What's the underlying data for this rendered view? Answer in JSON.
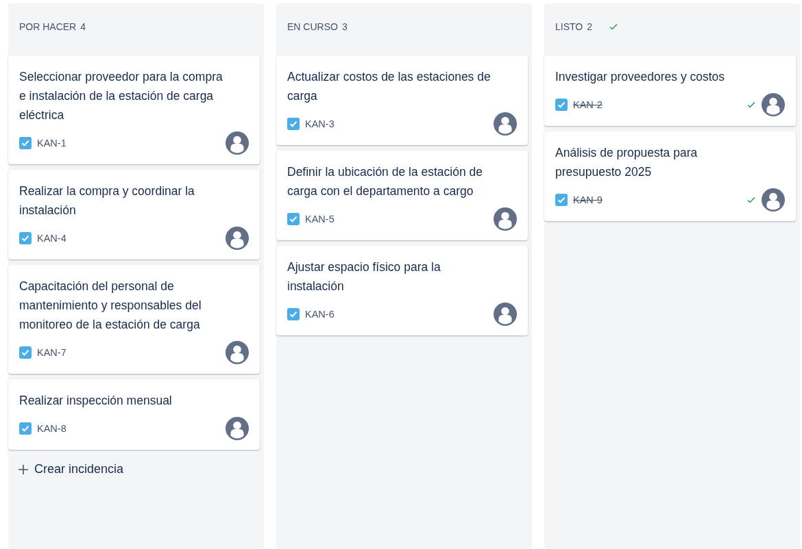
{
  "columns": [
    {
      "title": "POR HACER",
      "count": "4",
      "done": false,
      "cards": [
        {
          "title": "Seleccionar proveedor para la compra e instalación de la estación de carga eléctrica",
          "key": "KAN-1",
          "done": false
        },
        {
          "title": "Realizar la compra y coordinar la instalación",
          "key": "KAN-4",
          "done": false
        },
        {
          "title": "Capacitación del personal de mantenimiento y responsables del monitoreo de la estación de carga",
          "key": "KAN-7",
          "done": false
        },
        {
          "title": "Realizar inspección mensual",
          "key": "KAN-8",
          "done": false
        }
      ],
      "create_label": "Crear incidencia"
    },
    {
      "title": "EN CURSO",
      "count": "3",
      "done": false,
      "cards": [
        {
          "title": "Actualizar costos de las estaciones de carga",
          "key": "KAN-3",
          "done": false
        },
        {
          "title": "Definir la ubicación de la estación de carga con el departamento a cargo",
          "key": "KAN-5",
          "done": false
        },
        {
          "title": "Ajustar espacio físico para la instalación",
          "key": "KAN-6",
          "done": false
        }
      ]
    },
    {
      "title": "LISTO",
      "count": "2",
      "done": true,
      "cards": [
        {
          "title": "Investigar proveedores y costos",
          "key": "KAN-2",
          "done": true
        },
        {
          "title": "Análisis de propuesta para presupuesto 2025",
          "key": "KAN-9",
          "done": true
        }
      ]
    }
  ]
}
